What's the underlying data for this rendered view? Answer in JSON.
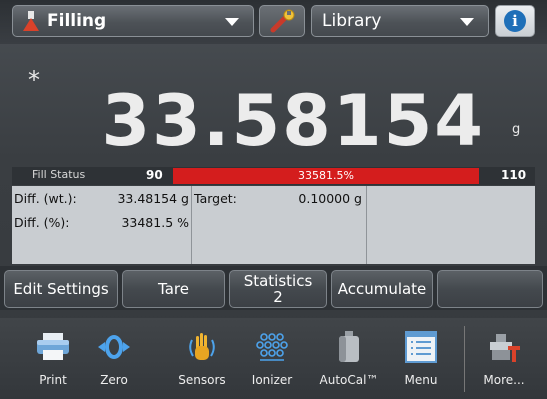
{
  "header": {
    "app_label": "Filling",
    "library_label": "Library"
  },
  "display": {
    "stability_symbol": "*",
    "weight": "33.58154",
    "unit": "g"
  },
  "fill_status": {
    "label": "Fill Status",
    "min": "90",
    "max": "110",
    "percent_text": "33581.5%",
    "progress_fraction": 1.0,
    "bar_color": "#d41d1d"
  },
  "results": {
    "diff_wt_label": "Diff. (wt.):",
    "diff_wt_value": "33.48154 g",
    "diff_pct_label": "Diff. (%):",
    "diff_pct_value": "33481.5 %",
    "target_label": "Target:",
    "target_value": "0.10000 g"
  },
  "softkeys": {
    "edit_settings": "Edit Settings",
    "tare": "Tare",
    "statistics": "Statistics",
    "statistics_count": "2",
    "accumulate": "Accumulate"
  },
  "nav": {
    "print": "Print",
    "zero": "Zero",
    "sensors": "Sensors",
    "ionizer": "Ionizer",
    "autocal": "AutoCal™",
    "menu": "Menu",
    "more": "More..."
  },
  "icons": {
    "app": "flask-icon",
    "library_caret": "chevron-down-icon",
    "settings": "wrench-icon",
    "info": "info-icon"
  }
}
